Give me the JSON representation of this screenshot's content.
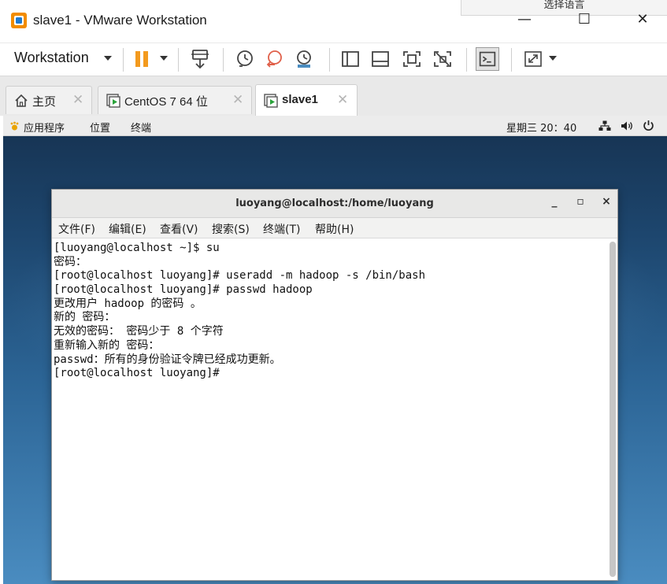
{
  "window": {
    "title": "slave1 - VMware Workstation",
    "lang_popup": "选择语言",
    "minimize": "—",
    "maximize": "☐",
    "close": "✕"
  },
  "toolbar": {
    "workstation_label": "Workstation"
  },
  "tabs": [
    {
      "label": "主页",
      "icon": "home-icon",
      "active": false
    },
    {
      "label": "CentOS 7 64 位",
      "icon": "vm-icon",
      "active": false
    },
    {
      "label": "slave1",
      "icon": "vm-icon",
      "active": true
    }
  ],
  "tab_close": "✕",
  "gnome": {
    "applications": "应用程序",
    "places": "位置",
    "terminal": "终端",
    "clock": "星期三 20：40"
  },
  "terminal": {
    "title": "luoyang@localhost:/home/luoyang",
    "minimize": "_",
    "maximize": "▫",
    "close": "×",
    "menus": [
      "文件(F)",
      "编辑(E)",
      "查看(V)",
      "搜索(S)",
      "终端(T)",
      "帮助(H)"
    ],
    "lines": [
      "[luoyang@localhost ~]$ su",
      "密码：",
      "[root@localhost luoyang]# useradd -m hadoop -s /bin/bash",
      "[root@localhost luoyang]# passwd hadoop",
      "更改用户 hadoop 的密码 。",
      "新的 密码：",
      "无效的密码： 密码少于 8 个字符",
      "重新输入新的 密码：",
      "passwd：所有的身份验证令牌已经成功更新。",
      "[root@localhost luoyang]# "
    ]
  },
  "colors": {
    "accent_orange": "#f28c00",
    "vm_blue": "#1f7ad0",
    "pause_orange": "#f39a1e"
  }
}
